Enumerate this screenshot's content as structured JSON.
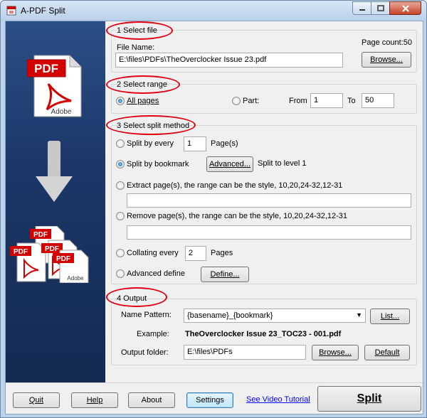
{
  "window": {
    "title": "A-PDF Split"
  },
  "icons": {
    "app": "pdf-split-app-icon",
    "minimize": "minimize-icon",
    "maximize": "maximize-icon",
    "close": "close-icon",
    "single_pdf": "pdf-document-icon",
    "arrow": "arrow-down-icon",
    "split_pdfs": "multiple-pdf-documents-icon"
  },
  "art": {
    "pdf": "PDF",
    "adobe": "Adobe"
  },
  "colors": {
    "highlight_ellipse": "#e00012",
    "link": "#0000ff",
    "panel": "#1c3768"
  },
  "section1": {
    "title": "1 Select file",
    "file_name_label": "File Name:",
    "file_name_value": "E:\\files\\PDFs\\TheOverclocker Issue 23.pdf",
    "page_count": "Page count:50",
    "browse": "Browse..."
  },
  "section2": {
    "title": "2 Select range",
    "all_pages": "All pages",
    "part": "Part:",
    "from_label": "From",
    "from_value": "1",
    "to_label": "To",
    "to_value": "50",
    "selected": "All pages"
  },
  "section3": {
    "title": "3 Select split method",
    "split_every_label": "Split by every",
    "split_every_value": "1",
    "pages_suffix": "Page(s)",
    "split_bookmark_label": "Split by bookmark",
    "advanced_button": "Advanced...",
    "split_level_text": "Split to level 1",
    "extract_label": "Extract page(s), the range can be the style, 10,20,24-32,12-31",
    "extract_value": "",
    "remove_label": "Remove page(s), the range can be the style, 10,20,24-32,12-31",
    "remove_value": "",
    "collating_label": "Collating every",
    "collating_value": "2",
    "collating_suffix": "Pages",
    "advanced_define_label": "Advanced define",
    "define_button": "Define...",
    "selected": "Split by bookmark"
  },
  "section4": {
    "title": "4 Output",
    "name_pattern_label": "Name Pattern:",
    "name_pattern_value": "{basename}_{bookmark}",
    "list_button": "List...",
    "example_label": "Example:",
    "example_value": "TheOverclocker Issue 23_TOC23 - 001.pdf",
    "output_folder_label": "Output folder:",
    "output_folder_value": "E:\\files\\PDFs",
    "browse_button": "Browse...",
    "default_button": "Default"
  },
  "footer": {
    "quit": "Quit",
    "help": "Help",
    "about": "About",
    "settings": "Settings",
    "video_link": "See Video Tutorial",
    "split": "Split"
  }
}
